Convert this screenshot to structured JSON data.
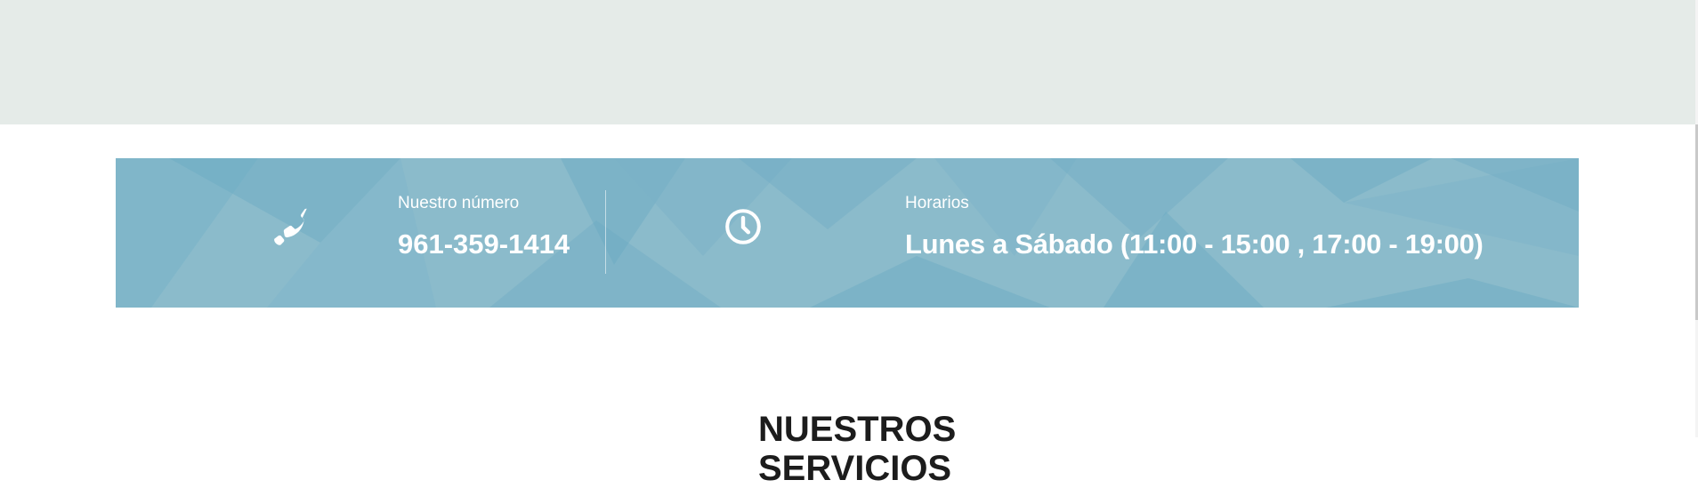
{
  "contact": {
    "phone_label": "Nuestro número",
    "phone_number": "961-359-1414",
    "phone_icon": "phone-icon"
  },
  "hours": {
    "label": "Horarios",
    "value": "Lunes a Sábado (11:00 - 15:00 , 17:00 - 19:00)",
    "icon": "clock-icon"
  },
  "services": {
    "heading_line_1": "NUESTROS",
    "heading_line_2": "SERVICIOS"
  },
  "colors": {
    "top_band": "#e5ebe8",
    "strip_base": "#8bbbcb",
    "strip_dark": "#6aaac4",
    "text_on_strip": "#ffffff",
    "heading_text": "#1c1c1c"
  }
}
